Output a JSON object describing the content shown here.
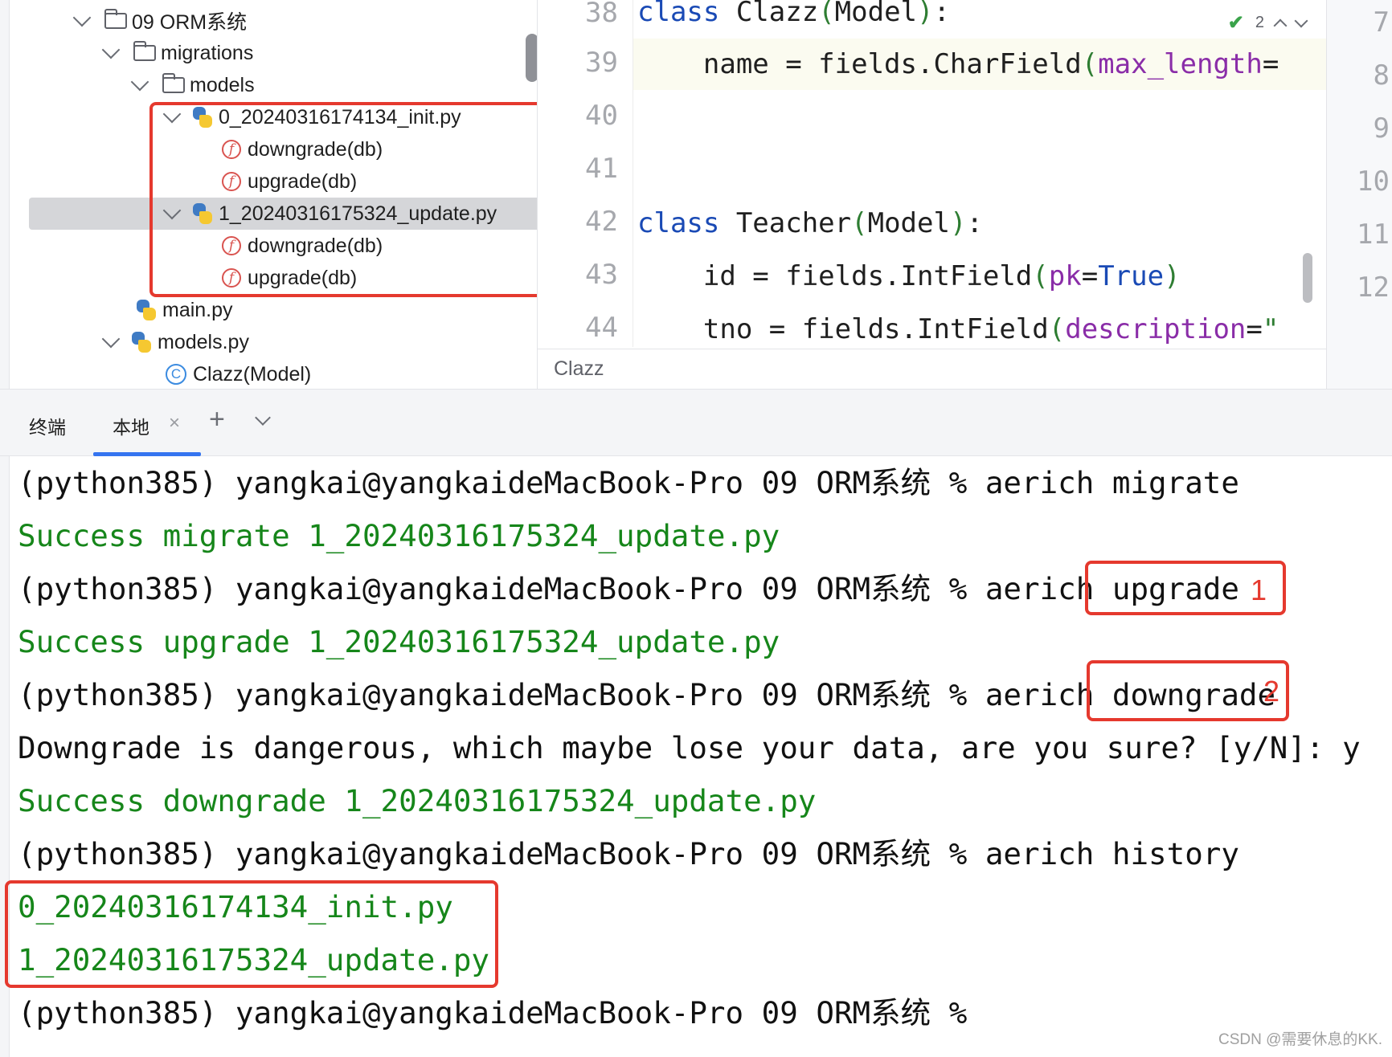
{
  "project_tree": {
    "items": [
      {
        "label": "09 ORM系统",
        "kind": "folder"
      },
      {
        "label": "migrations",
        "kind": "folder"
      },
      {
        "label": "models",
        "kind": "folder"
      },
      {
        "label": "0_20240316174134_init.py",
        "kind": "python-file"
      },
      {
        "label": "downgrade(db)",
        "kind": "function"
      },
      {
        "label": "upgrade(db)",
        "kind": "function"
      },
      {
        "label": "1_20240316175324_update.py",
        "kind": "python-file"
      },
      {
        "label": "downgrade(db)",
        "kind": "function"
      },
      {
        "label": "upgrade(db)",
        "kind": "function"
      },
      {
        "label": "main.py",
        "kind": "python-file"
      },
      {
        "label": "models.py",
        "kind": "python-file"
      },
      {
        "label": "Clazz(Model)",
        "kind": "class"
      }
    ]
  },
  "editor": {
    "line_numbers": [
      "38",
      "39",
      "40",
      "41",
      "42",
      "43",
      "44"
    ],
    "lines": {
      "l38": {
        "kw": "class",
        "name": " Clazz",
        "p1": "(",
        "base": "Model",
        "p2": ")",
        "colon": ":"
      },
      "l39": {
        "pre": "    name = fields.CharField",
        "p1": "(",
        "arg": "max_length",
        "eq": "="
      },
      "l42": {
        "kw": "class",
        "name": " Teacher",
        "p1": "(",
        "base": "Model",
        "p2": ")",
        "colon": ":"
      },
      "l43": {
        "pre": "    id = fields.IntField",
        "p1": "(",
        "arg": "pk",
        "eq": "=",
        "val": "True",
        "p2": ")"
      },
      "l44": {
        "pre": "    tno = fields.IntField",
        "p1": "(",
        "arg": "description",
        "eq": "=",
        "str": "\""
      }
    },
    "inspection_count": "2",
    "breadcrumb": "Clazz"
  },
  "right_panel": {
    "line_numbers": [
      "7",
      "8",
      "9",
      "10",
      "11",
      "12"
    ]
  },
  "terminal": {
    "tabs": {
      "title": "终端",
      "local": "本地",
      "close": "×",
      "add": "+"
    },
    "lines": [
      {
        "text": "(python385) yangkai@yangkaideMacBook-Pro 09 ORM系统 % aerich migrate",
        "color": "black"
      },
      {
        "text": "Success migrate 1_20240316175324_update.py",
        "color": "green"
      },
      {
        "text": "(python385) yangkai@yangkaideMacBook-Pro 09 ORM系统 % aerich upgrade",
        "color": "black"
      },
      {
        "text": "Success upgrade 1_20240316175324_update.py",
        "color": "green"
      },
      {
        "text": "(python385) yangkai@yangkaideMacBook-Pro 09 ORM系统 % aerich downgrade",
        "color": "black"
      },
      {
        "text": "Downgrade is dangerous, which maybe lose your data, are you sure? [y/N]: y",
        "color": "black"
      },
      {
        "text": "Success downgrade 1_20240316175324_update.py",
        "color": "green"
      },
      {
        "text": "(python385) yangkai@yangkaideMacBook-Pro 09 ORM系统 % aerich history",
        "color": "black"
      },
      {
        "text": "0_20240316174134_init.py",
        "color": "green"
      },
      {
        "text": "1_20240316175324_update.py",
        "color": "green"
      },
      {
        "text": "(python385) yangkai@yangkaideMacBook-Pro 09 ORM系统 %",
        "color": "black"
      }
    ],
    "annotations": {
      "upgrade": "1",
      "downgrade": "2"
    }
  },
  "watermark": "CSDN @需要休息的KK.",
  "colors": {
    "highlight_red": "#e5392e",
    "success_green": "#16861a",
    "keyword_blue": "#1a4ab5",
    "tab_accent": "#3574f0"
  }
}
